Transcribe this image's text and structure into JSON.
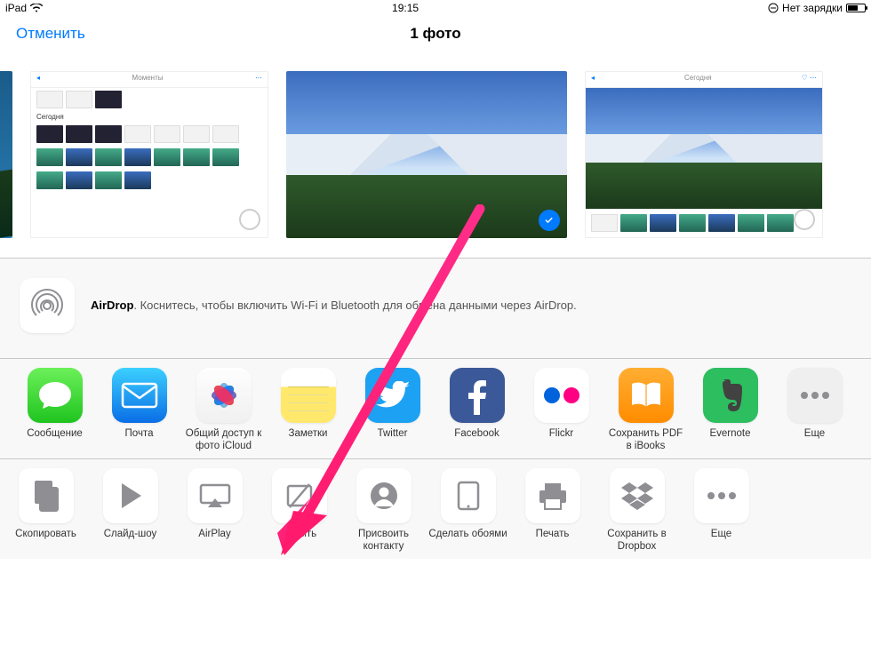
{
  "status": {
    "device": "iPad",
    "time": "19:15",
    "charging_text": "Нет зарядки"
  },
  "nav": {
    "cancel": "Отменить",
    "title": "1 фото"
  },
  "airdrop": {
    "bold": "AirDrop",
    "text": ". Коснитесь, чтобы включить Wi-Fi и Bluetooth для обмена данными через AirDrop."
  },
  "share_row": [
    {
      "label": "Сообщение"
    },
    {
      "label": "Почта"
    },
    {
      "label": "Общий доступ к фото iCloud"
    },
    {
      "label": "Заметки"
    },
    {
      "label": "Twitter"
    },
    {
      "label": "Facebook"
    },
    {
      "label": "Flickr"
    },
    {
      "label": "Сохранить PDF в iBooks"
    },
    {
      "label": "Evernote"
    },
    {
      "label": "Еще"
    }
  ],
  "action_row": [
    {
      "label": "Скопировать"
    },
    {
      "label": "Слайд-шоу"
    },
    {
      "label": "AirPlay"
    },
    {
      "label": "Скрыть"
    },
    {
      "label": "Присвоить контакту"
    },
    {
      "label": "Сделать обоями"
    },
    {
      "label": "Печать"
    },
    {
      "label": "Сохранить в Dropbox"
    },
    {
      "label": "Еще"
    }
  ],
  "photos": {
    "selected_index": 2
  }
}
